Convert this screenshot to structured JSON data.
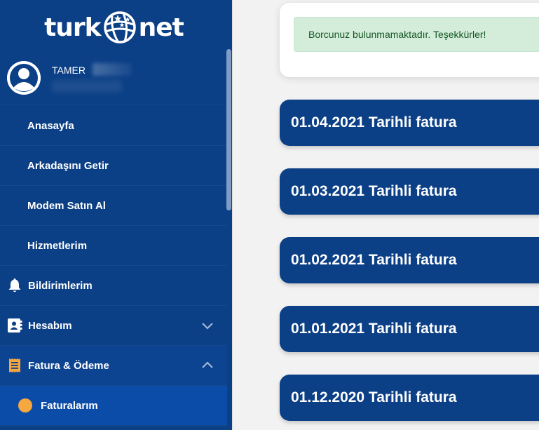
{
  "brand": {
    "left": "turk",
    "right": "net"
  },
  "user": {
    "name": "TAMER"
  },
  "menu": {
    "anasayfa": "Anasayfa",
    "arkadas": "Arkadaşını Getir",
    "modem": "Modem Satın Al",
    "hizmetler": "Hizmetlerim",
    "bildirimler": "Bildirimlerim",
    "hesabim": "Hesabım",
    "fatura": "Fatura & Ödeme",
    "faturalarim": "Faturalarım"
  },
  "alert": {
    "text": "Borcunuz bulunmamaktadır. Teşekkürler!"
  },
  "invoices": [
    "01.04.2021 Tarihli fatura",
    "01.03.2021 Tarihli fatura",
    "01.02.2021 Tarihli fatura",
    "01.01.2021 Tarihli fatura",
    "01.12.2020 Tarihli fatura"
  ],
  "colors": {
    "sidebar": "#0b3f86",
    "accent": "#f5a840",
    "alert_bg": "#d4edda",
    "alert_text": "#155724"
  }
}
